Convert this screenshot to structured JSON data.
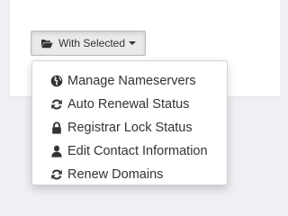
{
  "button": {
    "label": "With Selected",
    "icon": "folder-open-icon"
  },
  "menu": {
    "items": [
      {
        "label": "Manage Nameservers",
        "icon": "globe-icon"
      },
      {
        "label": "Auto Renewal Status",
        "icon": "refresh-icon"
      },
      {
        "label": "Registrar Lock Status",
        "icon": "lock-icon"
      },
      {
        "label": "Edit Contact Information",
        "icon": "user-icon"
      },
      {
        "label": "Renew Domains",
        "icon": "refresh-icon"
      }
    ]
  },
  "colors": {
    "page_background": "#eef0f3",
    "panel_background": "#ffffff",
    "button_background": "#eaeaea",
    "text": "#333333"
  }
}
